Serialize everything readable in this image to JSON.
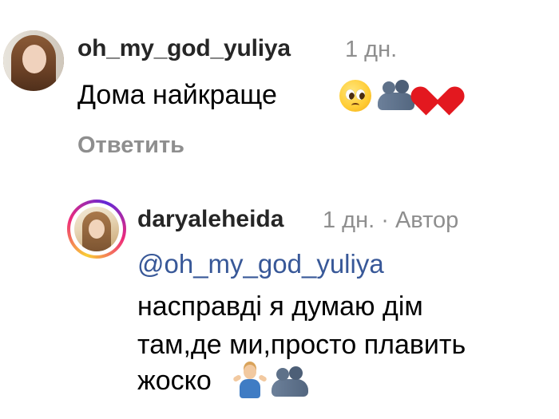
{
  "comment": {
    "username": "oh_my_god_yuliya",
    "time": "1 дн.",
    "text": "Дома найкраще",
    "emojis": [
      "pleading-face",
      "people-hugging",
      "red-heart"
    ],
    "reply_label": "Ответить"
  },
  "reply": {
    "username": "daryaleheida",
    "time": "1 дн. · Автор",
    "mention": "@oh_my_god_yuliya",
    "lines": [
      "насправді я думаю дім",
      "там,де ми,просто плавить",
      "жоско"
    ],
    "emojis": [
      "person-shrugging",
      "people-hugging"
    ],
    "has_story_ring": true
  },
  "colors": {
    "username": "#262626",
    "meta": "#8e8e8e",
    "mention": "#385898",
    "heart": "#e3181f"
  }
}
